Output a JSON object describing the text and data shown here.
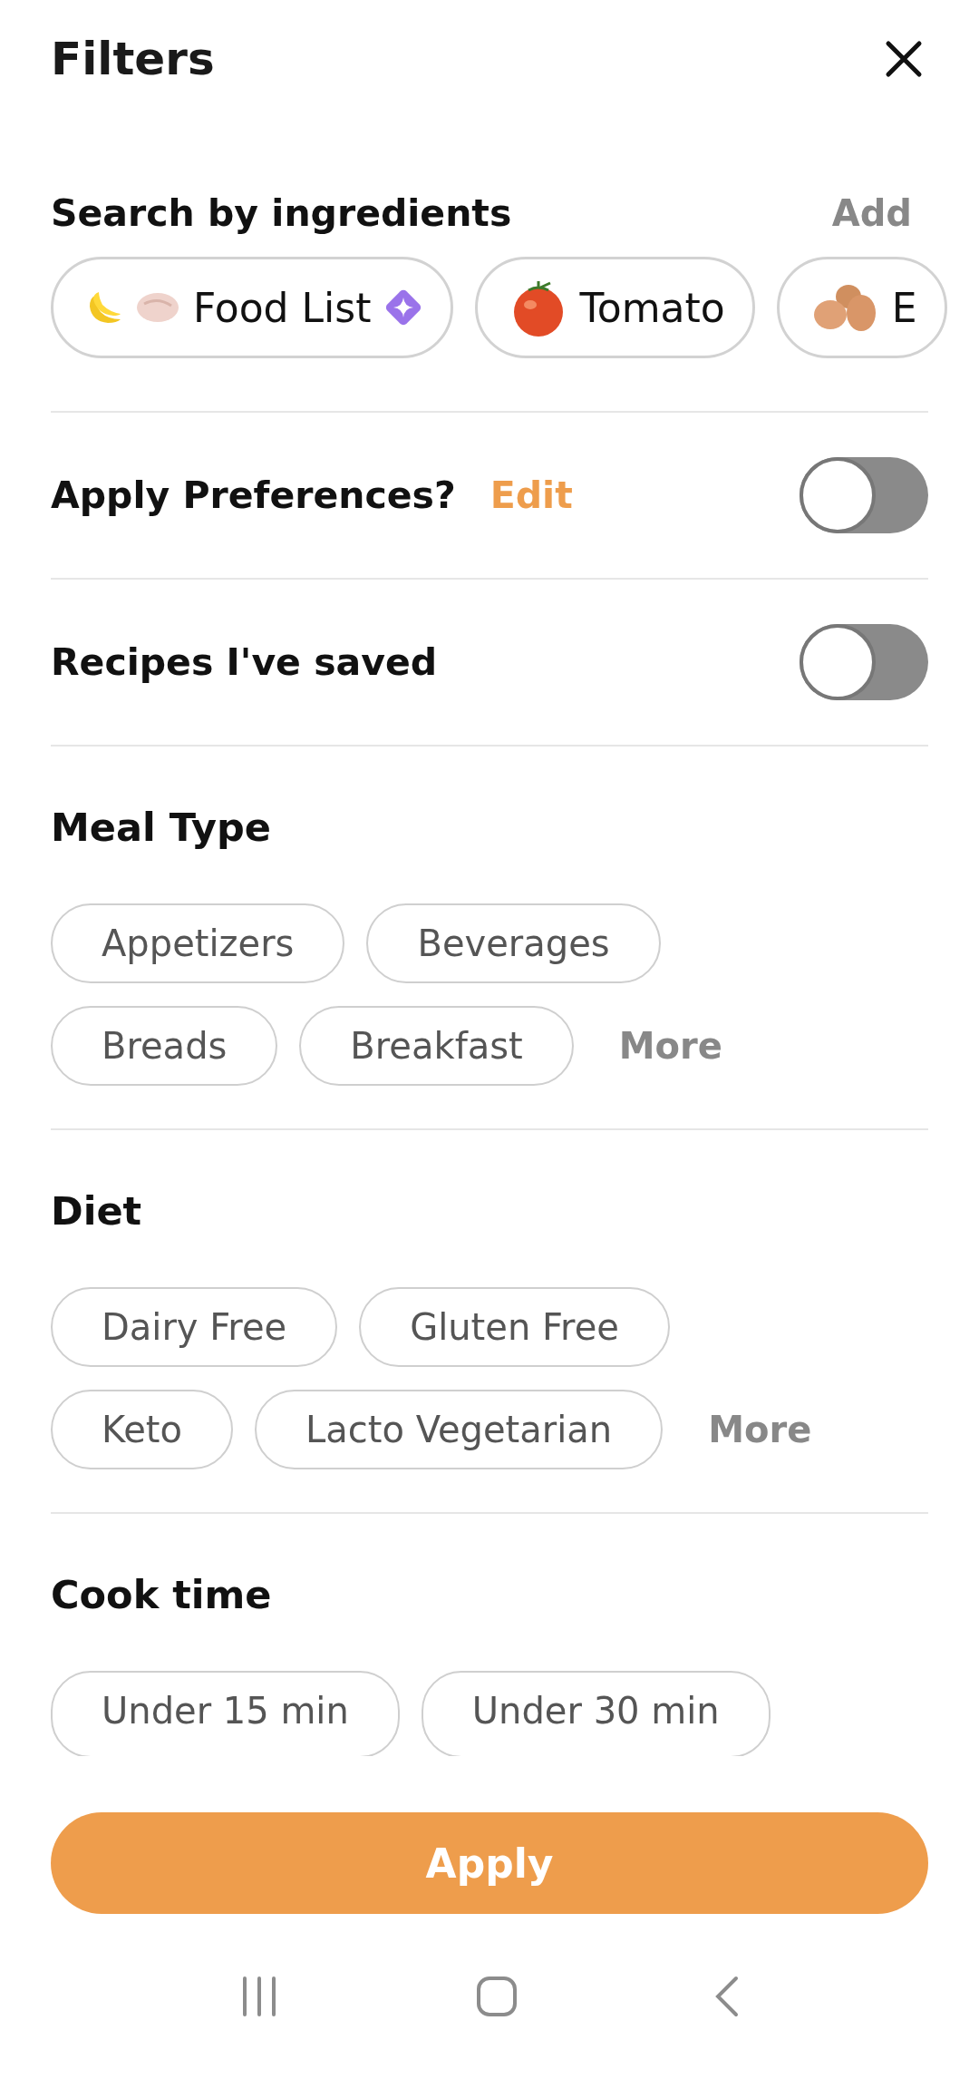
{
  "header": {
    "title": "Filters"
  },
  "ingredients": {
    "title": "Search by ingredients",
    "action": "Add",
    "chips": [
      {
        "label": "Food List",
        "kind": "list"
      },
      {
        "label": "Tomato",
        "kind": "tomato"
      },
      {
        "label": "E",
        "kind": "eggs"
      }
    ]
  },
  "toggles": [
    {
      "label": "Apply Preferences?",
      "link": "Edit",
      "on": false
    },
    {
      "label": "Recipes I've saved",
      "on": false
    }
  ],
  "filter_groups": [
    {
      "title": "Meal Type",
      "rows": [
        [
          "Appetizers",
          "Beverages"
        ],
        [
          "Breads",
          "Breakfast"
        ]
      ],
      "more": "More"
    },
    {
      "title": "Diet",
      "rows": [
        [
          "Dairy Free",
          "Gluten Free"
        ],
        [
          "Keto",
          "Lacto Vegetarian"
        ]
      ],
      "more": "More"
    }
  ],
  "cook_time": {
    "title": "Cook time",
    "options": [
      "Under 15 min",
      "Under 30 min"
    ]
  },
  "apply_button": "Apply"
}
